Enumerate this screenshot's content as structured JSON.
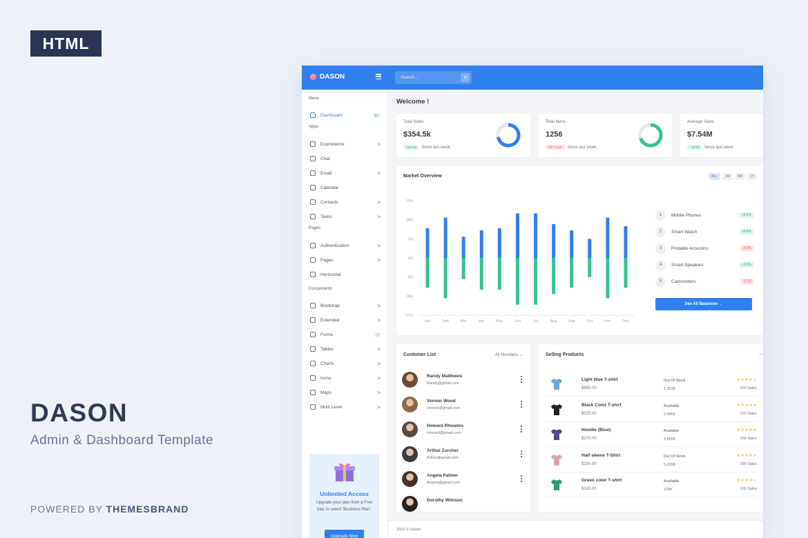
{
  "promo": {
    "badge": "HTML",
    "title": "DASON",
    "subtitle": "Admin & Dashboard Template",
    "powered_prefix": "POWERED BY",
    "powered_brand": "THEMESBRAND"
  },
  "topbar": {
    "logo": "DASON",
    "search_placeholder": "Search...",
    "accent": "#2f80ed"
  },
  "sidebar": {
    "sections": [
      "Menu",
      "Apps",
      "Pages",
      "Components"
    ],
    "dashboard": {
      "label": "Dashboard",
      "badge": "9+"
    },
    "apps": [
      {
        "label": "Ecommerce",
        "icon": "cart-icon",
        "chevron": ">"
      },
      {
        "label": "Chat",
        "icon": "chat-icon",
        "chevron": ""
      },
      {
        "label": "Email",
        "icon": "mail-icon",
        "chevron": ">"
      },
      {
        "label": "Calendar",
        "icon": "calendar-icon",
        "chevron": ""
      },
      {
        "label": "Contacts",
        "icon": "users-icon",
        "chevron": ">"
      },
      {
        "label": "Tasks",
        "icon": "tasks-icon",
        "chevron": ">"
      }
    ],
    "pages": [
      {
        "label": "Authentication",
        "icon": "layers-icon",
        "chevron": ">"
      },
      {
        "label": "Pages",
        "icon": "file-icon",
        "chevron": ">"
      },
      {
        "label": "Horizontal",
        "icon": "layout-icon",
        "chevron": ""
      }
    ],
    "components": [
      {
        "label": "Bootstrap",
        "icon": "briefcase-icon",
        "chevron": ">"
      },
      {
        "label": "Extended",
        "icon": "gift-icon",
        "chevron": ">"
      },
      {
        "label": "Forms",
        "icon": "box-icon",
        "badge": "7"
      },
      {
        "label": "Tables",
        "icon": "sliders-icon",
        "chevron": ">"
      },
      {
        "label": "Charts",
        "icon": "pie-chart-icon",
        "chevron": ">"
      },
      {
        "label": "Icons",
        "icon": "globe-icon",
        "chevron": ">"
      },
      {
        "label": "Maps",
        "icon": "map-icon",
        "chevron": ">"
      },
      {
        "label": "Multi Level",
        "icon": "share-icon",
        "chevron": ">"
      }
    ],
    "upgrade": {
      "title": "Unlimited Access",
      "text": "Upgrade your plan from a Free trial, to select 'Business Plan'.",
      "button": "Upgrade Now"
    }
  },
  "main": {
    "welcome": "Welcome !",
    "stats": [
      {
        "label": "Total Sales",
        "value": "$354.5k",
        "chip": "+$20.9k",
        "chip_type": "green",
        "foot": "Since last week",
        "donut_pct": 72,
        "donut_color": "#2f80ed"
      },
      {
        "label": "Total Items",
        "value": "1256",
        "chip": "-29 Trades",
        "chip_type": "red",
        "foot": "Since last week",
        "donut_pct": 70,
        "donut_color": "#34c38f"
      },
      {
        "label": "Average Sales",
        "value": "$7.54M",
        "chip": "+ $2.8k",
        "chip_type": "green",
        "foot": "Since last week"
      }
    ],
    "market": {
      "title": "Market Overview",
      "ranges": [
        "ALL",
        "1M",
        "6M",
        "1Y"
      ],
      "active_range": "ALL",
      "products": [
        {
          "num": "1",
          "name": "Mobile Phones",
          "change": "+5.4%",
          "type": "green"
        },
        {
          "num": "2",
          "name": "Smart Watch",
          "change": "+6.8%",
          "type": "green"
        },
        {
          "num": "3",
          "name": "Protable Acoustics",
          "change": "-4.9%",
          "type": "red"
        },
        {
          "num": "4",
          "name": "Smart Speakers",
          "change": "+3.5%",
          "type": "green"
        },
        {
          "num": "5",
          "name": "Camcorders",
          "change": "-0.3%",
          "type": "red"
        }
      ],
      "button": "See All Balances"
    },
    "customers": {
      "title": "Customer List",
      "filter": "All Members",
      "list": [
        {
          "name": "Randy Matthews",
          "email": "Randy@gmail.com",
          "avatar_color": "#6b4a3a"
        },
        {
          "name": "Vernon Wood",
          "email": "Vernon@gmail.com",
          "avatar_color": "#8a6a4a"
        },
        {
          "name": "Howard Rhoades",
          "email": "Howard@gmail.com",
          "avatar_color": "#5a4a44"
        },
        {
          "name": "Arthur Zurcher",
          "email": "Arthur@gmail.com",
          "avatar_color": "#3f3a3a"
        },
        {
          "name": "Angela Palmer",
          "email": "Angela@gmail.com",
          "avatar_color": "#4a2f2a"
        },
        {
          "name": "Dorothy Wimson",
          "email": "",
          "avatar_color": "#2a2222"
        }
      ]
    },
    "selling": {
      "title": "Selling Products",
      "more": "···",
      "products": [
        {
          "name": "Light blue T-shirt",
          "price": "$650.00",
          "status": "Out Of Stock",
          "stock": "1,253K",
          "rating": 4,
          "sales": "260 Sales",
          "color": "#6fa6d8"
        },
        {
          "name": "Black Color T-shirt",
          "price": "$325.00",
          "status": "Available",
          "stock": "2,586K",
          "rating": 5,
          "sales": "220 Sales",
          "color": "#222222"
        },
        {
          "name": "Hoodie (Blue)",
          "price": "$170.00",
          "status": "Available",
          "stock": "4,565K",
          "rating": 5,
          "sales": "165 Sales",
          "color": "#4d4a8f"
        },
        {
          "name": "Half sleeve T-Shirt",
          "price": "$150.00",
          "status": "Out Of Stock",
          "stock": "5,265K",
          "rating": 4,
          "sales": "165 Sales",
          "color": "#e0a3ad"
        },
        {
          "name": "Green color T-shirt",
          "price": "$120.00",
          "status": "Available",
          "stock": "125K",
          "rating": 4,
          "sales": "165 Sales",
          "color": "#2f9a73"
        }
      ]
    },
    "footer": "2023 © Dason."
  },
  "chart_data": {
    "type": "bar",
    "categories": [
      "Jan",
      "Feb",
      "Mar",
      "Apr",
      "May",
      "Jun",
      "Jul",
      "Aug",
      "Sep",
      "Oct",
      "Nov",
      "Dec"
    ],
    "series": [
      {
        "values": [
          14,
          19,
          10,
          13,
          14,
          21,
          21,
          16,
          13,
          9,
          19,
          15
        ],
        "color": "#2f80ed"
      },
      {
        "values": [
          -14,
          -19,
          -10,
          -15,
          -15,
          -22,
          -22,
          -17,
          -14,
          -9,
          -19,
          -14
        ],
        "color": "#34c38f"
      }
    ],
    "ylim": [
      -27,
      27
    ],
    "yticks": [
      "27%",
      "18%",
      "9%",
      "0%",
      "-9%",
      "-18%",
      "-27%"
    ],
    "grid": false
  }
}
